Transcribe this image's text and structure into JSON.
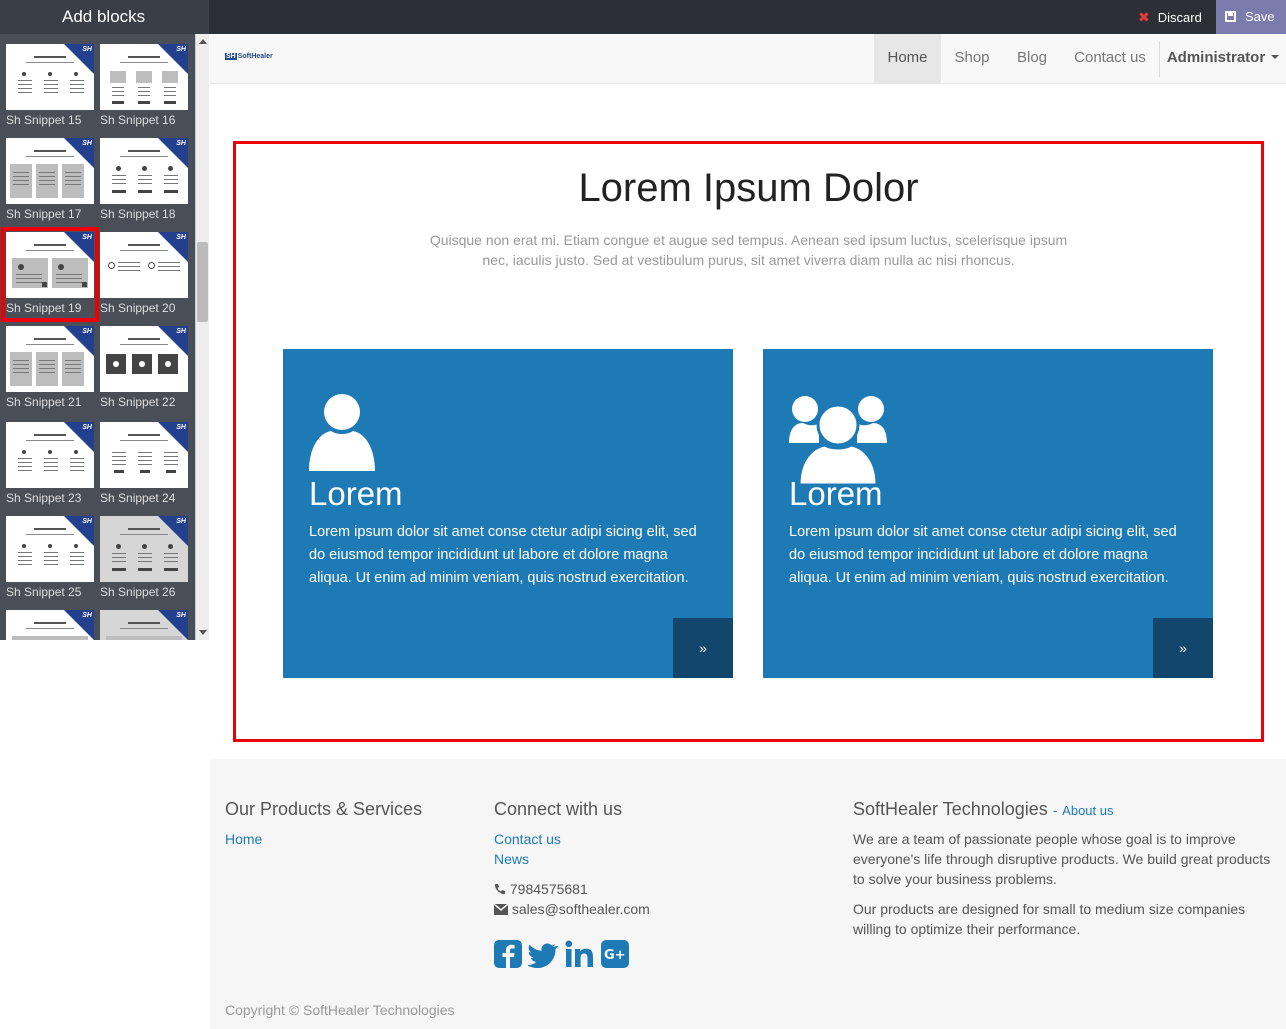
{
  "editor": {
    "panel_title": "Add blocks",
    "discard_label": "Discard",
    "save_label": "Save"
  },
  "snippets": [
    {
      "label": "Sh Snippet 15"
    },
    {
      "label": "Sh Snippet 16"
    },
    {
      "label": "Sh Snippet 17"
    },
    {
      "label": "Sh Snippet 18"
    },
    {
      "label": "Sh Snippet 19"
    },
    {
      "label": "Sh Snippet 20"
    },
    {
      "label": "Sh Snippet 21"
    },
    {
      "label": "Sh Snippet 22"
    },
    {
      "label": "Sh Snippet 23"
    },
    {
      "label": "Sh Snippet 24"
    },
    {
      "label": "Sh Snippet 25"
    },
    {
      "label": "Sh Snippet 26"
    }
  ],
  "snippet_badge": "SH",
  "nav": {
    "logo": "SoftHealer",
    "logo_mark": "SH",
    "items": [
      "Home",
      "Shop",
      "Blog",
      "Contact us"
    ],
    "user": "Administrator"
  },
  "section": {
    "title": "Lorem Ipsum Dolor",
    "subtitle": "Quisque non erat mi. Etiam congue et augue sed tempus. Aenean sed ipsum luctus, scelerisque ipsum nec, iaculis justo. Sed at vestibulum purus, sit amet viverra diam nulla ac nisi rhoncus.",
    "cards": [
      {
        "icon": "user-icon",
        "title": "Lorem",
        "text": "Lorem ipsum dolor sit amet conse ctetur adipi sicing elit, sed do eiusmod tempor incididunt ut labore et dolore magna aliqua. Ut enim ad minim veniam, quis nostrud exercitation.",
        "more": "»"
      },
      {
        "icon": "users-icon",
        "title": "Lorem",
        "text": "Lorem ipsum dolor sit amet conse ctetur adipi sicing elit, sed do eiusmod tempor incididunt ut labore et dolore magna aliqua. Ut enim ad minim veniam, quis nostrud exercitation.",
        "more": "»"
      }
    ]
  },
  "footer": {
    "products_heading": "Our Products & Services",
    "products_links": [
      "Home"
    ],
    "connect_heading": "Connect with us",
    "connect_links": [
      "Contact us",
      "News"
    ],
    "phone": "7984575681",
    "email": "sales@softhealer.com",
    "about_heading": "SoftHealer Technologies",
    "about_link": "About us",
    "about_sep": "-",
    "about_p1": "We are a team of passionate people whose goal is to improve everyone's life through disruptive products. We build great products to solve your business problems.",
    "about_p2": "Our products are designed for small to medium size companies willing to optimize their performance.",
    "copyright": "Copyright © SoftHealer Technologies"
  },
  "colors": {
    "card_blue": "#1e7ab5",
    "card_button": "#12466c",
    "save_purple": "#7c7bad",
    "selection_red": "#e00000"
  }
}
